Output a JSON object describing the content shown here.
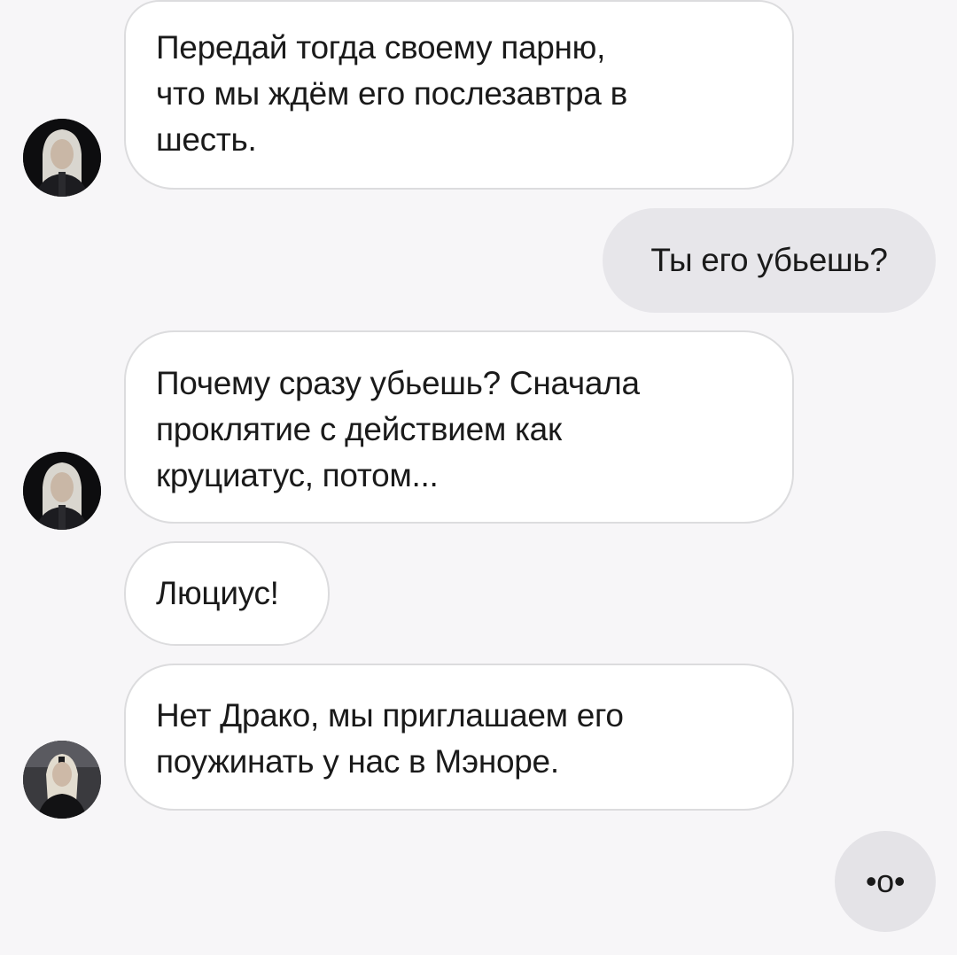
{
  "chat": {
    "messages": [
      {
        "sender": "contact",
        "avatar": "lucius-avatar",
        "lines": [
          "Передай тогда своему парню,",
          "что мы ждём его послезавтра в",
          "шесть."
        ]
      },
      {
        "sender": "self",
        "lines": [
          "Ты его убьешь?"
        ]
      },
      {
        "sender": "contact",
        "avatar": "lucius-avatar",
        "lines": [
          "Почему сразу убьешь? Сначала",
          "проклятие с действием как",
          "круциатус, потом..."
        ]
      },
      {
        "sender": "contact",
        "lines": [
          "Люциус!"
        ]
      },
      {
        "sender": "contact",
        "avatar": "narcissa-avatar",
        "lines": [
          "Нет Драко, мы приглашаем его",
          "поужинать у нас в Мэноре."
        ]
      },
      {
        "sender": "self",
        "lines": [
          "•о•"
        ]
      }
    ]
  },
  "colors": {
    "background": "#f7f6f8",
    "incoming_bubble": "#ffffff",
    "incoming_border": "#dcdcde",
    "outgoing_bubble": "#e7e6ea",
    "text": "#1a1a1a"
  }
}
